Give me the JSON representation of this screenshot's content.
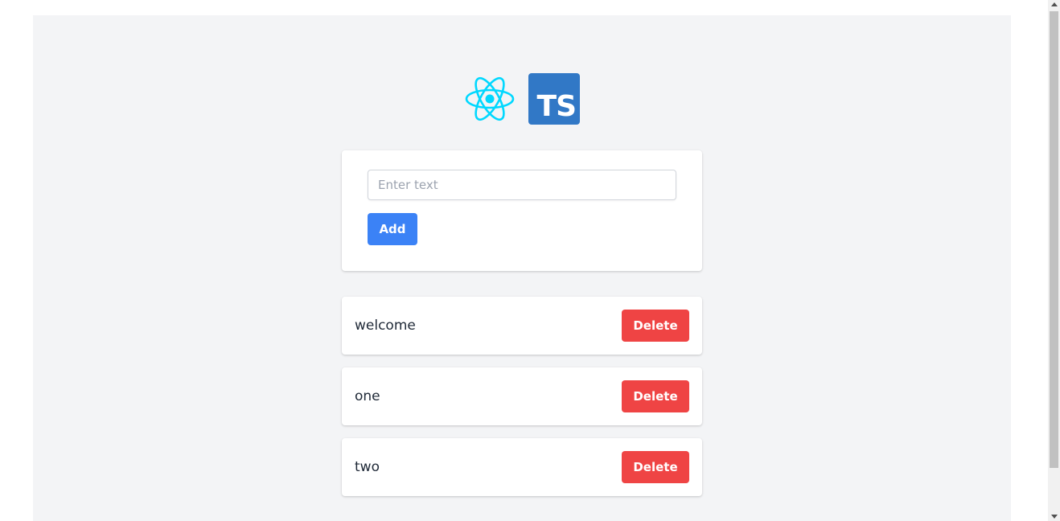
{
  "form": {
    "input_placeholder": "Enter text",
    "input_value": "",
    "add_label": "Add"
  },
  "logos": {
    "react": "react-logo-icon",
    "typescript_text": "TS"
  },
  "items": [
    {
      "label": "welcome",
      "delete_label": "Delete"
    },
    {
      "label": "one",
      "delete_label": "Delete"
    },
    {
      "label": "two",
      "delete_label": "Delete"
    }
  ],
  "colors": {
    "background": "#f3f4f6",
    "primary": "#3b82f6",
    "danger": "#ef4444",
    "react": "#00d8ff",
    "typescript": "#3178c6"
  }
}
